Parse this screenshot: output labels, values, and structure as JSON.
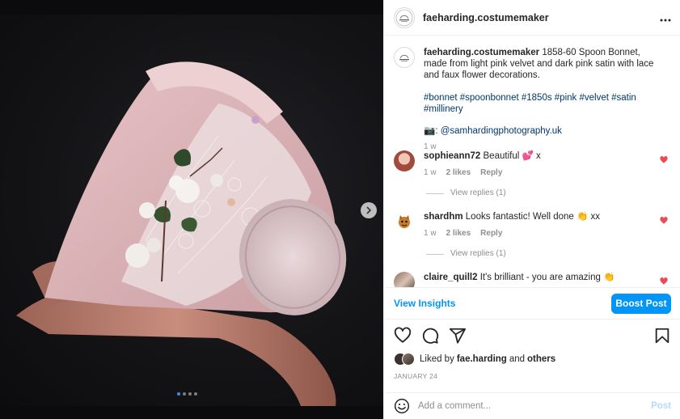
{
  "media": {
    "carousel_count": 4,
    "carousel_active": 0,
    "next_icon": "chevron-right-icon"
  },
  "header": {
    "username": "faeharding.costumemaker",
    "more_icon": "more-horizontal-icon"
  },
  "caption": {
    "username": "faeharding.costumemaker",
    "text": "1858-60 Spoon Bonnet, made from light pink velvet and dark pink satin with lace and faux flower decorations.",
    "hashtags": "#bonnet #spoonbonnet #1850s #pink #velvet #satin #millinery",
    "credit_prefix": "📷: ",
    "credit_handle": "@samhardingphotography.uk",
    "time": "1 w"
  },
  "comments": [
    {
      "username": "sophieann72",
      "text": "Beautiful 💕 x",
      "time": "1 w",
      "likes": "2 likes",
      "reply": "Reply",
      "view_replies": "View replies (1)"
    },
    {
      "username": "shardhm",
      "text": "Looks fantastic! Well done 👏 xx",
      "time": "1 w",
      "likes": "2 likes",
      "reply": "Reply",
      "view_replies": "View replies (1)"
    },
    {
      "username": "claire_quill2",
      "text": "It's brilliant - you are amazing 👏"
    }
  ],
  "insights": {
    "view_label": "View Insights",
    "boost_label": "Boost Post"
  },
  "likes": {
    "prefix": "Liked by ",
    "user": "fae.harding",
    "middle": " and ",
    "others": "others"
  },
  "date": "JANUARY 24",
  "add_comment": {
    "placeholder": "Add a comment...",
    "post_label": "Post"
  },
  "colors": {
    "accent": "#0095f6",
    "heart": "#ed4956"
  }
}
